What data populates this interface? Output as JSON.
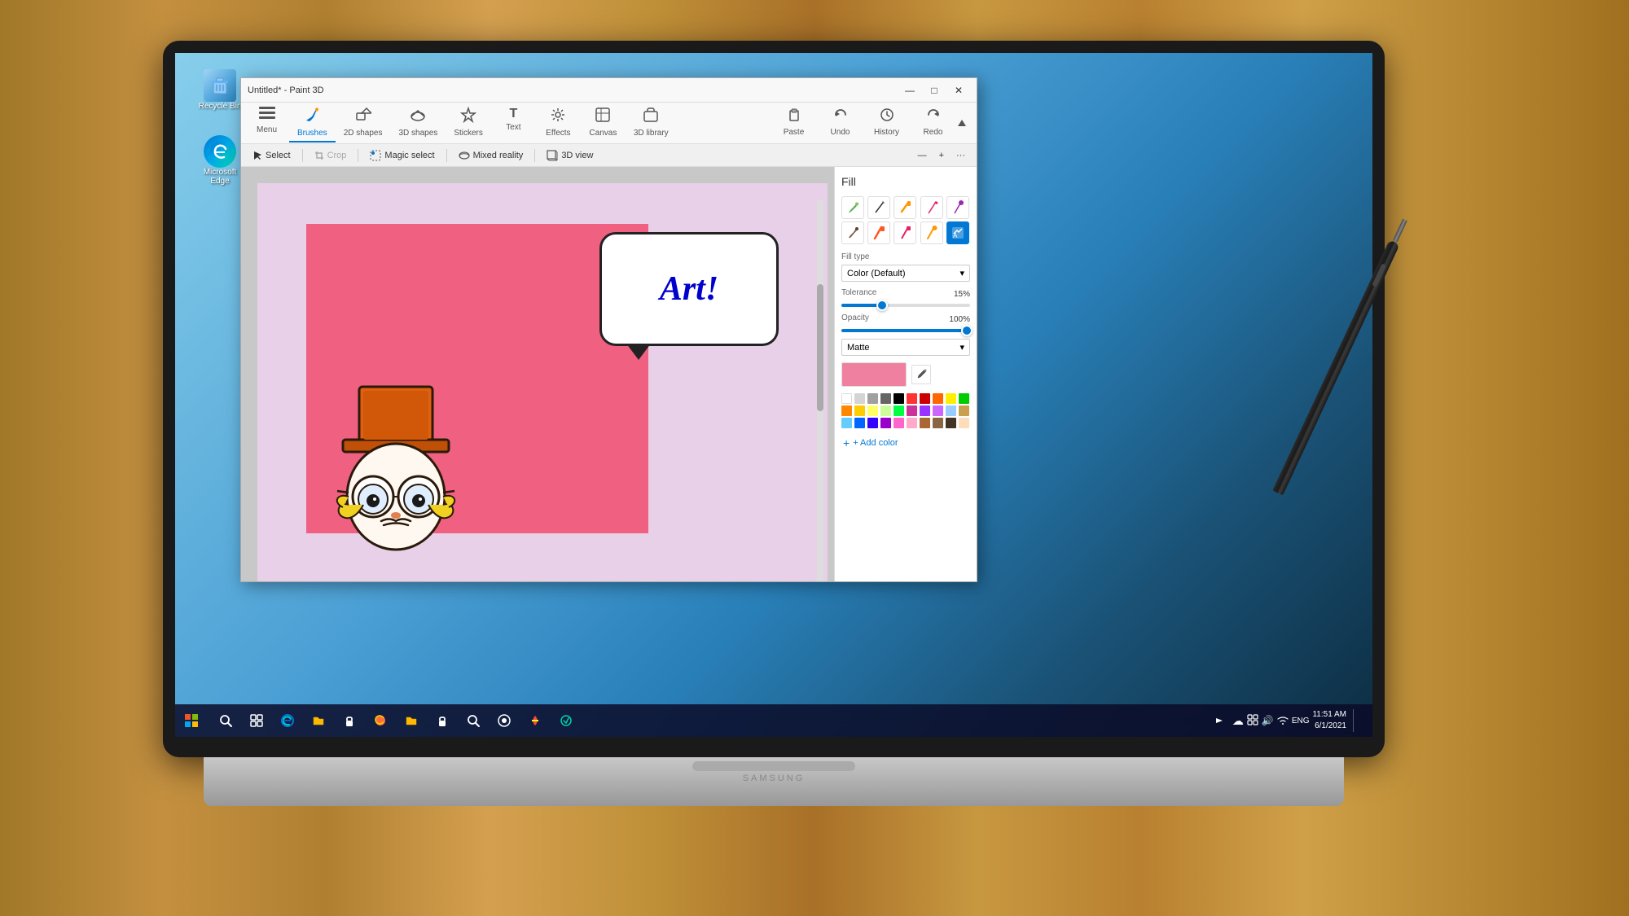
{
  "desktop": {
    "icons": [
      {
        "id": "recycle-bin",
        "label": "Recycle Bin",
        "symbol": "🗑"
      },
      {
        "id": "edge",
        "label": "Microsoft Edge",
        "symbol": "e"
      }
    ]
  },
  "window": {
    "title": "Untitled* - Paint 3D",
    "controls": {
      "minimize": "—",
      "maximize": "□",
      "close": "✕"
    }
  },
  "ribbon": {
    "tabs": [
      {
        "id": "menu",
        "label": "Menu",
        "icon": "☰"
      },
      {
        "id": "brushes",
        "label": "Brushes",
        "icon": "🖌",
        "active": true
      },
      {
        "id": "2dshapes",
        "label": "2D shapes",
        "icon": "⬡"
      },
      {
        "id": "3dshapes",
        "label": "3D shapes",
        "icon": "⬡"
      },
      {
        "id": "stickers",
        "label": "Stickers",
        "icon": "✿"
      },
      {
        "id": "text",
        "label": "Text",
        "icon": "T"
      },
      {
        "id": "effects",
        "label": "Effects",
        "icon": "✦"
      },
      {
        "id": "canvas",
        "label": "Canvas",
        "icon": "⊞"
      },
      {
        "id": "3dlibrary",
        "label": "3D library",
        "icon": "📦"
      }
    ],
    "actions": [
      {
        "id": "paste",
        "label": "Paste",
        "icon": "📋"
      },
      {
        "id": "undo",
        "label": "Undo",
        "icon": "↶"
      },
      {
        "id": "history",
        "label": "History",
        "icon": "🕐"
      },
      {
        "id": "redo",
        "label": "Redo",
        "icon": "↷"
      }
    ]
  },
  "toolbar": {
    "items": [
      {
        "id": "select",
        "label": "Select",
        "icon": "↖"
      },
      {
        "id": "crop",
        "label": "Crop",
        "icon": "✂"
      },
      {
        "id": "magic-select",
        "label": "Magic select",
        "icon": "⬡"
      },
      {
        "id": "mixed-reality",
        "label": "Mixed reality",
        "icon": "🌐"
      },
      {
        "id": "3dview",
        "label": "3D view",
        "icon": "🔲"
      }
    ]
  },
  "fill_panel": {
    "title": "Fill",
    "brushes": [
      {
        "id": "brush1",
        "symbol": "🖌",
        "color": "#4CAF50"
      },
      {
        "id": "brush2",
        "symbol": "✏",
        "color": "#333"
      },
      {
        "id": "brush3",
        "symbol": "🖊",
        "color": "#FF9800"
      },
      {
        "id": "brush4",
        "symbol": "✏",
        "color": "#E91E63"
      },
      {
        "id": "brush5",
        "symbol": "✏",
        "color": "#9C27B0"
      },
      {
        "id": "brush6",
        "symbol": "🖌",
        "color": "#795548"
      },
      {
        "id": "brush7",
        "symbol": "🖊",
        "color": "#FF5722"
      },
      {
        "id": "brush8",
        "symbol": "✏",
        "color": "#E91E63"
      },
      {
        "id": "brush9",
        "symbol": "🖊",
        "color": "#FF9800"
      },
      {
        "id": "brush10",
        "symbol": "✦",
        "color": "#0078d4",
        "active": true
      }
    ],
    "fill_type_label": "Fill type",
    "fill_type_value": "Color (Default)",
    "tolerance_label": "Tolerance",
    "tolerance_value": "15%",
    "opacity_label": "Opacity",
    "opacity_value": "100%",
    "finish_label": "Matte",
    "current_color": "#f080a0",
    "add_color_label": "+ Add color"
  },
  "colors": [
    "#ffffff",
    "#d4d4d4",
    "#a0a0a0",
    "#666666",
    "#000000",
    "#ff0000",
    "#cc0000",
    "#ff8c00",
    "#ffff00",
    "#00ff00",
    "#008000",
    "#00ffff",
    "#0000ff",
    "#800080",
    "#ff00ff",
    "#ffcccc",
    "#ff6666",
    "#ff9999",
    "#ccffcc",
    "#66ff66",
    "#ff8800",
    "#ffcc00",
    "#ffff66",
    "#ccff99",
    "#00cc66",
    "#6666ff",
    "#9933ff",
    "#cc66ff",
    "#99ccff",
    "#c8a050"
  ],
  "taskbar": {
    "time": "11:51 AM",
    "date": "6/1/2021",
    "start_icon": "⊞",
    "search_icon": "🔍",
    "task_view": "🗗",
    "icons": [
      "🔍",
      "🌐",
      "📁",
      "🔒",
      "🦊",
      "📁",
      "🔒",
      "🔍",
      "🎙",
      "💧"
    ]
  }
}
